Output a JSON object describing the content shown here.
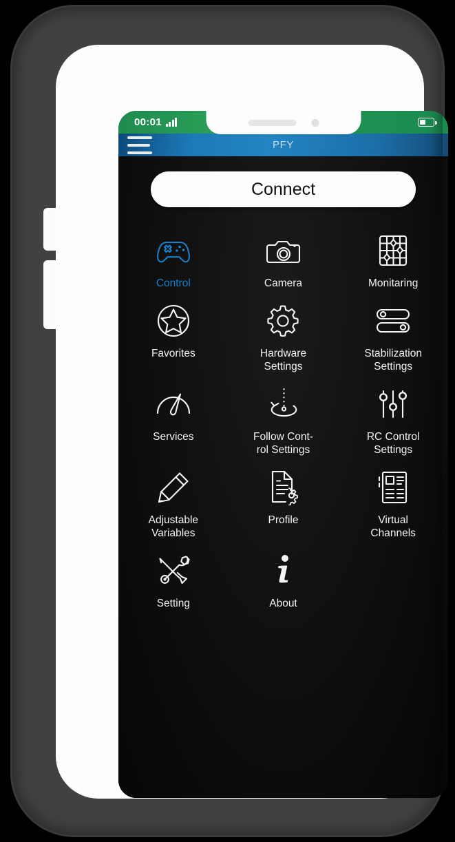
{
  "device": {
    "frame": "smartphone-notch",
    "buttons": [
      "volume-up",
      "volume-down",
      "power"
    ]
  },
  "statusbar": {
    "clock": "00:01",
    "signal_icon": "signal-bars-icon",
    "signal_bars": 4,
    "battery_icon": "battery-icon",
    "battery_level_pct": 38,
    "background_color": "#249a56"
  },
  "appbar": {
    "title": "PFY",
    "menu_icon": "hamburger-menu-icon",
    "background_color": "#1d79b8",
    "title_color": "#d2dde4"
  },
  "main": {
    "connect_label": "Connect",
    "accent_color": "#1c7fc9",
    "background_color": "#121212",
    "tiles": [
      {
        "label": "Control",
        "icon": "gamepad-icon",
        "active": true
      },
      {
        "label": "Camera",
        "icon": "camera-icon",
        "active": false
      },
      {
        "label": "Monitaring",
        "icon": "grid-monitor-icon",
        "active": false
      },
      {
        "label": "Favorites",
        "icon": "star-circle-icon",
        "active": false
      },
      {
        "label": "Hardware\nSettings",
        "icon": "gear-icon",
        "active": false
      },
      {
        "label": "Stabilization\nSettings",
        "icon": "toggle-switches-icon",
        "active": false
      },
      {
        "label": "Services",
        "icon": "gauge-icon",
        "active": false
      },
      {
        "label": "Follow Cont-\nrol Settings",
        "icon": "rotation-arrow-icon",
        "active": false
      },
      {
        "label": "RC Control\nSettings",
        "icon": "vertical-sliders-icon",
        "active": false
      },
      {
        "label": "Adjustable\nVariables",
        "icon": "pencil-icon",
        "active": false
      },
      {
        "label": "Profile",
        "icon": "document-gear-icon",
        "active": false
      },
      {
        "label": "Virtual\nChannels",
        "icon": "article-list-icon",
        "active": false
      },
      {
        "label": "Setting",
        "icon": "wrench-screwdriver-icon",
        "active": false
      },
      {
        "label": "About",
        "icon": "info-i-icon",
        "active": false
      }
    ]
  }
}
